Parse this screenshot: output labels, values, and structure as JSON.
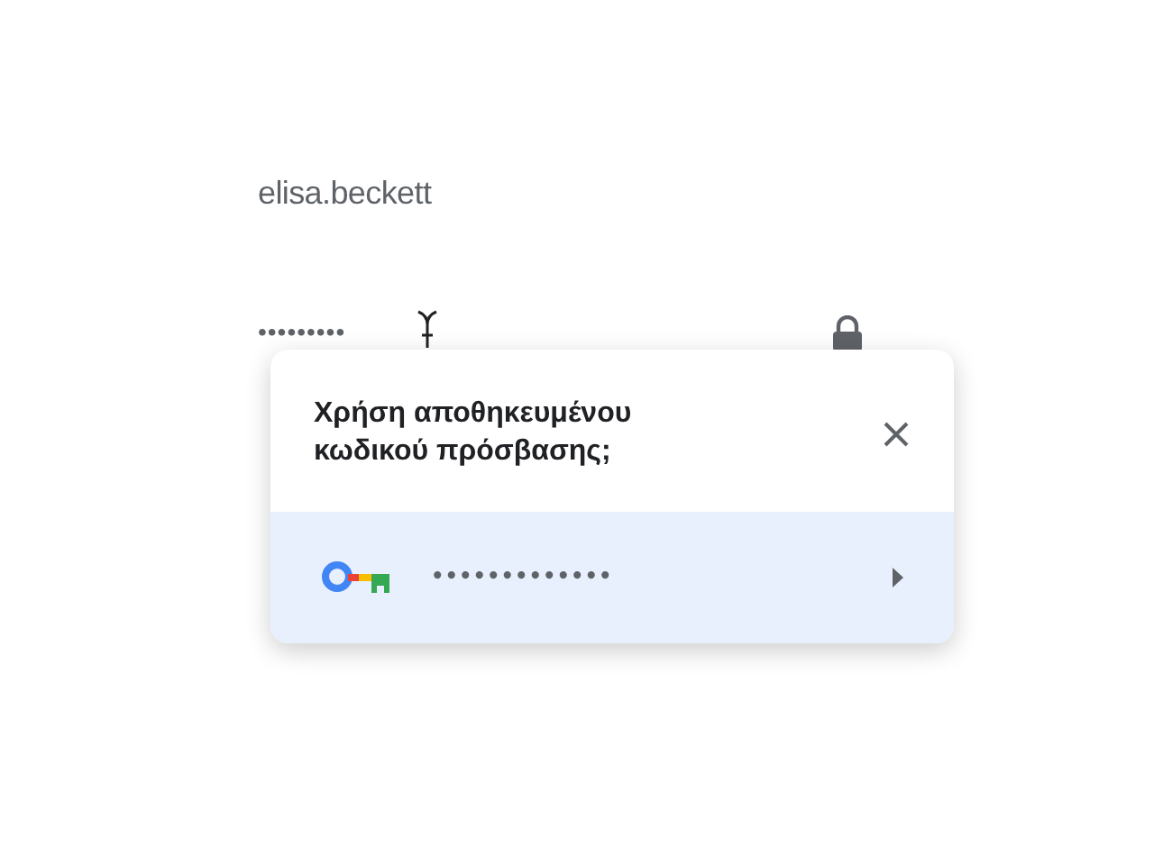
{
  "username": {
    "value": "elisa.beckett"
  },
  "password": {
    "value": "•••••••••"
  },
  "popup": {
    "title": "Χρήση αποθηκευμένου κωδικού πρόσβασης;",
    "suggestion": {
      "password": "•••••••••••••",
      "selected": true
    }
  }
}
